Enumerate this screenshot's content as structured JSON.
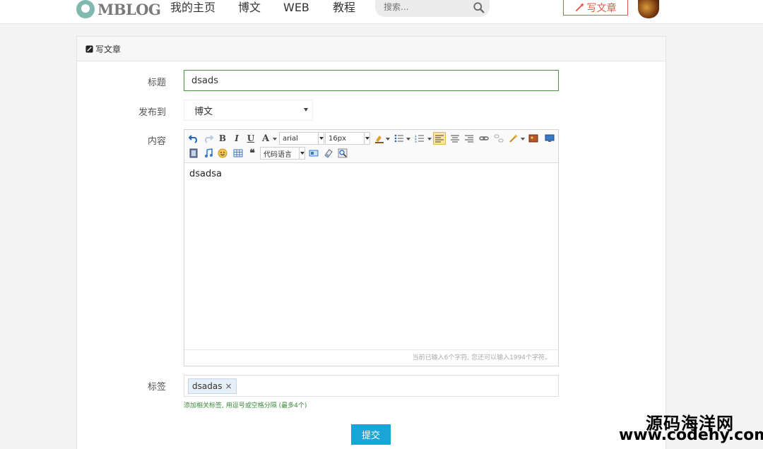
{
  "nav": {
    "logo_text": "MBLOG",
    "links": [
      "我的主页",
      "博文",
      "WEB",
      "教程"
    ],
    "search_placeholder": "搜索...",
    "write_label": "写文章"
  },
  "card": {
    "header": "写文章"
  },
  "form": {
    "title_label": "标题",
    "title_value": "dsads",
    "publish_label": "发布到",
    "publish_value": "博文",
    "content_label": "内容",
    "toolbar": {
      "font_family": "arial",
      "font_size": "16px",
      "code_lang": "代码语言"
    },
    "content_text": "dsadsa",
    "status_text": "当前已输入6个字符, 您还可以输入1994个字符。",
    "tags_label": "标签",
    "tags": [
      "dsadas"
    ],
    "tags_help": "添加相关标签, 用逗号或空格分隔 (最多4个)",
    "submit_label": "提交"
  },
  "watermark": {
    "line1": "源码海洋网",
    "line2": "www.codehy.com"
  }
}
